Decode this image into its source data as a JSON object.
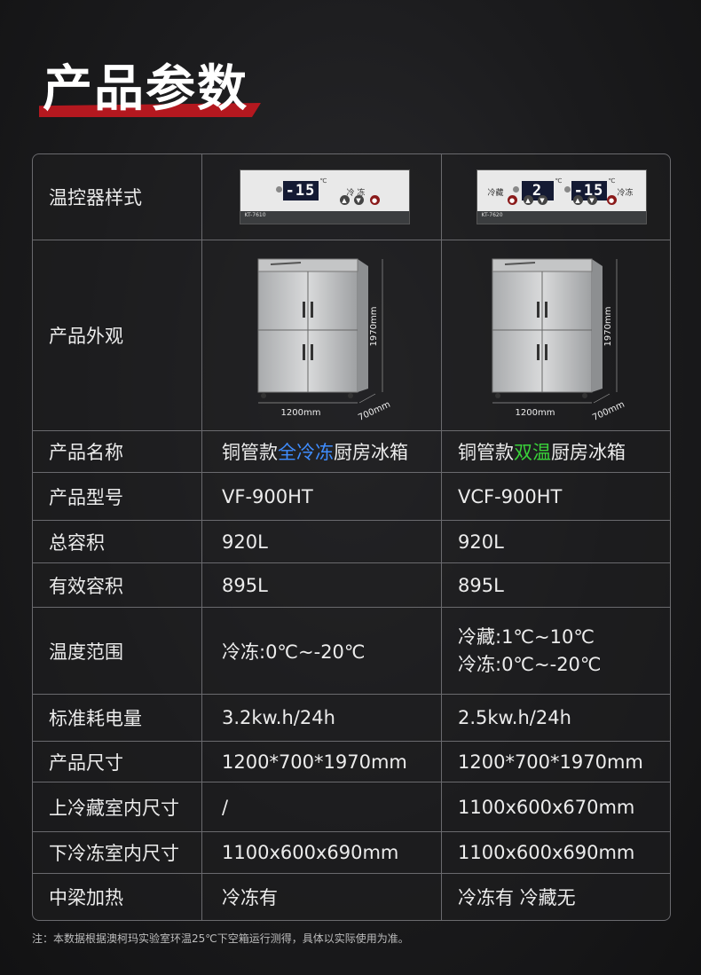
{
  "title": "产品参数",
  "rows": [
    {
      "label": "温控器样式"
    },
    {
      "label": "产品外观"
    },
    {
      "label": "产品名称",
      "a": {
        "pre": "铜管款",
        "hl": "全冷冻",
        "post": "厨房冰箱",
        "hl_color": "#3f8dff"
      },
      "b": {
        "pre": "铜管款",
        "hl": "双温",
        "post": "厨房冰箱",
        "hl_color": "#3ad23a"
      }
    },
    {
      "label": "产品型号",
      "a": "VF-900HT",
      "b": "VCF-900HT"
    },
    {
      "label": "总容积",
      "a": "920L",
      "b": "920L"
    },
    {
      "label": "有效容积",
      "a": "895L",
      "b": "895L"
    },
    {
      "label": "温度范围",
      "a": "冷冻:0℃~-20℃",
      "b1": "冷藏:1℃~10℃",
      "b2": "冷冻:0℃~-20℃"
    },
    {
      "label": "标准耗电量",
      "a": "3.2kw.h/24h",
      "b": "2.5kw.h/24h"
    },
    {
      "label": "产品尺寸",
      "a": "1200*700*1970mm",
      "b": "1200*700*1970mm"
    },
    {
      "label": "上冷藏室内尺寸",
      "a": "/",
      "b": "1100x600x670mm"
    },
    {
      "label": "下冷冻室内尺寸",
      "a": "1100x600x690mm",
      "b": "1100x600x690mm"
    },
    {
      "label": "中梁加热",
      "a": "冷冻有",
      "b": "冷冻有 冷藏无"
    }
  ],
  "thermostat_a": {
    "display": "-15",
    "unit": "℃",
    "mode": "冷 冻",
    "model": "KT-7610"
  },
  "thermostat_b": {
    "display_left": "2",
    "display_right": "-15",
    "unit": "℃",
    "mode_left": "冷藏",
    "mode_right": "冷冻",
    "model": "KT-7620"
  },
  "fridge_dims": {
    "height": "1970mm",
    "width": "1200mm",
    "depth": "700mm"
  },
  "note": "注：本数据根据澳柯玛实验室环温25℃下空箱运行测得，具体以实际使用为准。"
}
